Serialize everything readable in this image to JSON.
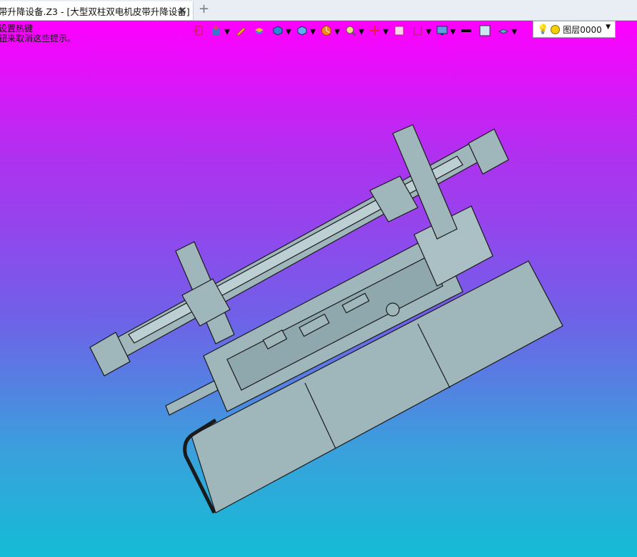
{
  "tab": {
    "title": "带升降设备.Z3 - [大型双柱双电机皮带升降设备]",
    "close_glyph": "✕",
    "add_glyph": "+"
  },
  "hint": {
    "line1": "设置热键",
    "line2": "钮来取消这些提示。"
  },
  "toolbar": {
    "icons": [
      "exit-sketch-icon",
      "paint-bucket-icon",
      "pencil-icon",
      "stack-icon",
      "cube-shaded-icon",
      "cube-view-icon",
      "pie-filter-icon",
      "zoom-icon",
      "target-icon",
      "frame-icon",
      "bracket-icon",
      "monitor-icon",
      "line-color-icon",
      "fill-color-icon",
      "layer-stack-icon"
    ],
    "layer_name": "图层0000"
  },
  "colors": {
    "model_fill": "#9fb6bb",
    "model_stroke": "#1a1a1a"
  }
}
